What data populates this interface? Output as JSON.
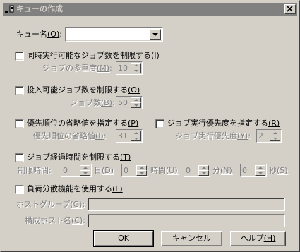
{
  "window": {
    "title": "キューの作成",
    "icon": "queue-window-icon"
  },
  "queue_name": {
    "label": "キュー名",
    "accel": "(Q)",
    "colon": ":",
    "value": ""
  },
  "concurrent_limit": {
    "checkbox_label": "同時実行可能なジョブ数を制限する",
    "checkbox_accel": "(J)",
    "checked": false,
    "sub_label": "ジョブの多重度",
    "sub_accel": "(M)",
    "colon": ":",
    "value": "10"
  },
  "submit_limit": {
    "checkbox_label": "投入可能ジョブ数を制限する",
    "checkbox_accel": "(O)",
    "checked": false,
    "sub_label": "ジョブ数",
    "sub_accel": "(B)",
    "colon": ":",
    "value": "50"
  },
  "priority": {
    "checkbox_label": "優先順位の省略値を指定する",
    "checkbox_accel": "(P)",
    "checked": false,
    "sub_label": "優先順位の省略値",
    "sub_accel": "(I)",
    "colon": ":",
    "value": "31"
  },
  "exec_priority": {
    "checkbox_label": "ジョブ実行優先度を指定する",
    "checkbox_accel": "(R)",
    "checked": false,
    "sub_label": "ジョブ実行優先度",
    "sub_accel": "(Y)",
    "colon": ":",
    "value": "2"
  },
  "elapsed_limit": {
    "checkbox_label": "ジョブ経過時間を制限する",
    "checkbox_accel": "(T)",
    "checked": false,
    "limit_label": "制限時間",
    "colon": ":",
    "days_value": "0",
    "days_label": "日",
    "days_accel": "(D)",
    "hours_value": "0",
    "hours_label": "時間",
    "hours_accel": "(U)",
    "minutes_value": "0",
    "minutes_label": "分",
    "minutes_accel": "(N)",
    "seconds_value": "0",
    "seconds_label": "秒",
    "seconds_accel": "(S)"
  },
  "load_balance": {
    "checkbox_label": "負荷分散機能を使用する",
    "checkbox_accel": "(L)",
    "checked": false,
    "host_group_label": "ホストグループ",
    "host_group_accel": "(G)",
    "host_group_value": "",
    "host_name_label": "構成ホスト名",
    "host_name_accel": "(C)",
    "host_name_value": "",
    "colon": ":"
  },
  "buttons": {
    "ok": "OK",
    "cancel": "キャンセル",
    "help": "ヘルプ",
    "help_accel": "(H)"
  }
}
